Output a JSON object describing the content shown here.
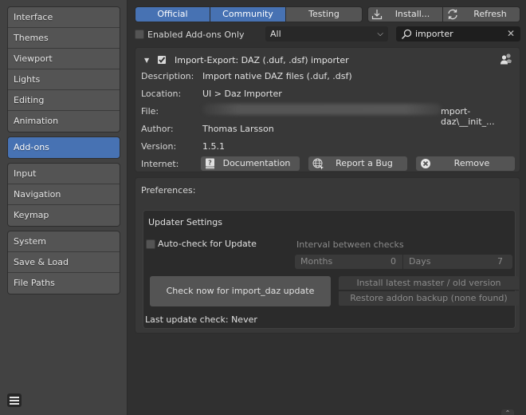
{
  "sidebar": {
    "groups": [
      {
        "items": [
          "Interface",
          "Themes",
          "Viewport",
          "Lights",
          "Editing",
          "Animation"
        ]
      },
      {
        "items": [
          "Add-ons"
        ],
        "active": true
      },
      {
        "items": [
          "Input",
          "Navigation",
          "Keymap"
        ]
      },
      {
        "items": [
          "System",
          "Save & Load",
          "File Paths"
        ]
      }
    ],
    "menu_icon": "hamburger-icon"
  },
  "toolbar": {
    "tabs": [
      {
        "label": "Official",
        "active": true
      },
      {
        "label": "Community",
        "active": true
      },
      {
        "label": "Testing",
        "active": false
      }
    ],
    "install_label": "Install...",
    "refresh_label": "Refresh",
    "enabled_only_label": "Enabled Add-ons Only",
    "enabled_only_checked": false,
    "category_value": "All",
    "search_value": "importer"
  },
  "addon": {
    "title": "Import-Export: DAZ (.duf, .dsf) importer",
    "enabled": true,
    "expanded": true,
    "rows": {
      "description_label": "Description:",
      "description_value": "Import native DAZ files (.duf, .dsf)",
      "location_label": "Location:",
      "location_value": "UI > Daz Importer",
      "file_label": "File:",
      "file_value_visible": "mport-daz\\__init_...",
      "author_label": "Author:",
      "author_value": "Thomas Larsson",
      "version_label": "Version:",
      "version_value": "1.5.1",
      "internet_label": "Internet:"
    },
    "buttons": {
      "documentation": "Documentation",
      "report_bug": "Report a Bug",
      "remove": "Remove"
    }
  },
  "preferences": {
    "label": "Preferences:",
    "updater": {
      "title": "Updater Settings",
      "auto_check_label": "Auto-check for Update",
      "auto_check_checked": false,
      "interval_label": "Interval between checks",
      "months_label": "Months",
      "months_value": "0",
      "days_label": "Days",
      "days_value": "7",
      "check_now_label": "Check now for import_daz update",
      "install_latest_label": "Install latest master / old version",
      "restore_backup_label": "Restore addon backup (none found)",
      "last_check_label": "Last update check: Never"
    }
  }
}
